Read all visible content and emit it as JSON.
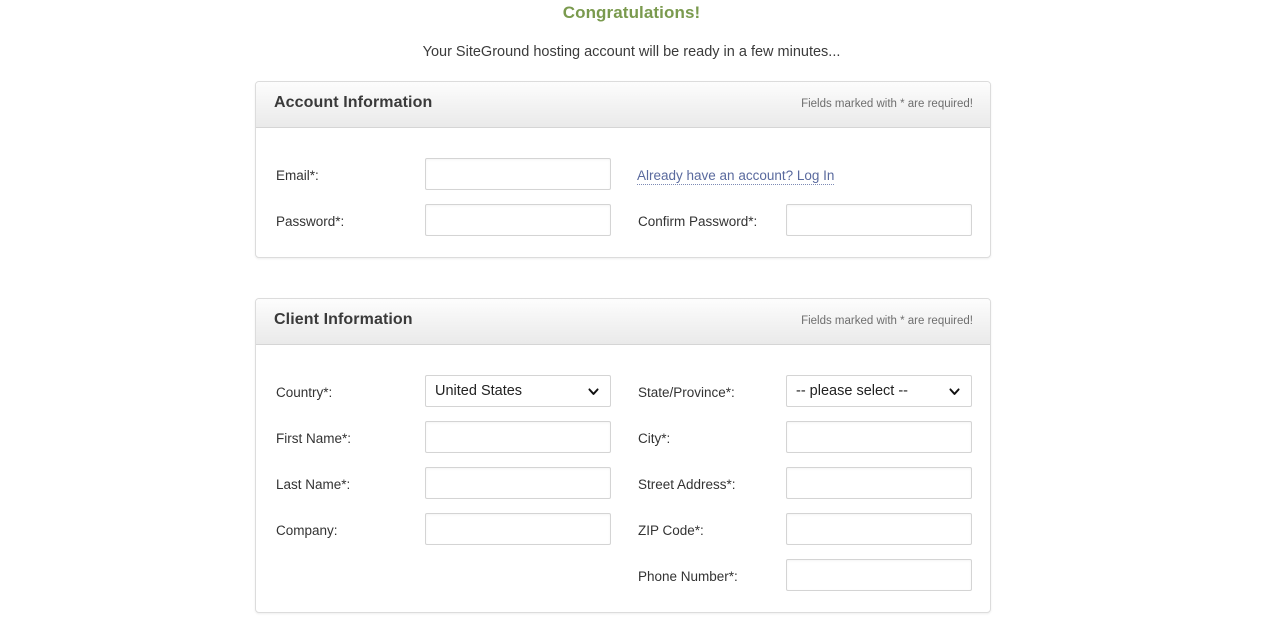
{
  "header": {
    "congratulations": "Congratulations!",
    "subtitle": "Your SiteGround hosting account will be ready in a few minutes..."
  },
  "colors": {
    "heading_green": "#7a9a4e",
    "link_blue": "#5a6a9e",
    "panel_border": "#dcdcdc",
    "input_border": "#d4d4d4",
    "label_text": "#333333",
    "note_text": "#6e6e6e"
  },
  "panels": [
    {
      "id": "account-information",
      "title": "Account Information",
      "note": "Fields marked with * are required!",
      "fields": {
        "email_label": "Email*:",
        "email_value": "",
        "password_label": "Password*:",
        "password_value": "",
        "confirm_password_label": "Confirm Password*:",
        "confirm_password_value": "",
        "login_link": "Already have an account? Log In"
      }
    },
    {
      "id": "client-information",
      "title": "Client Information",
      "note": "Fields marked with * are required!",
      "fields": {
        "country_label": "Country*:",
        "country_value": "United States",
        "state_label": "State/Province*:",
        "state_value": "-- please select --",
        "first_name_label": "First Name*:",
        "first_name_value": "",
        "city_label": "City*:",
        "city_value": "",
        "last_name_label": "Last Name*:",
        "last_name_value": "",
        "street_address_label": "Street Address*:",
        "street_address_value": "",
        "company_label": "Company:",
        "company_value": "",
        "zip_code_label": "ZIP Code*:",
        "zip_code_value": "",
        "phone_number_label": "Phone Number*:",
        "phone_number_value": ""
      },
      "options": {
        "country": [
          "United States"
        ],
        "state": [
          "-- please select --"
        ]
      }
    }
  ],
  "icons": {
    "chevron_down": "chevron-down-icon"
  }
}
